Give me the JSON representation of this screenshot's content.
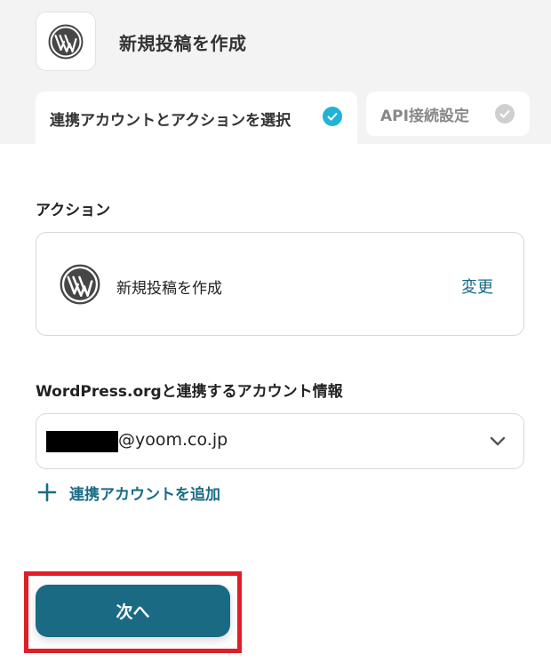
{
  "header": {
    "title": "新規投稿を作成",
    "app_icon": "wordpress-logo"
  },
  "tabs": [
    {
      "label": "連携アカウントとアクションを選択",
      "status": "completed",
      "check_color": "#21b2d6"
    },
    {
      "label": "API接続設定",
      "status": "pending",
      "check_color": "#cfcfcf"
    }
  ],
  "action_section": {
    "label": "アクション",
    "action_name": "新規投稿を作成",
    "change_label": "変更"
  },
  "account_section": {
    "label": "WordPress.orgと連携するアカウント情報",
    "selected_account": "@yoom.co.jp",
    "add_account_label": "連携アカウントを追加"
  },
  "footer": {
    "next_label": "次へ",
    "accent_color": "#196a82",
    "highlight_color": "#e01e25"
  }
}
